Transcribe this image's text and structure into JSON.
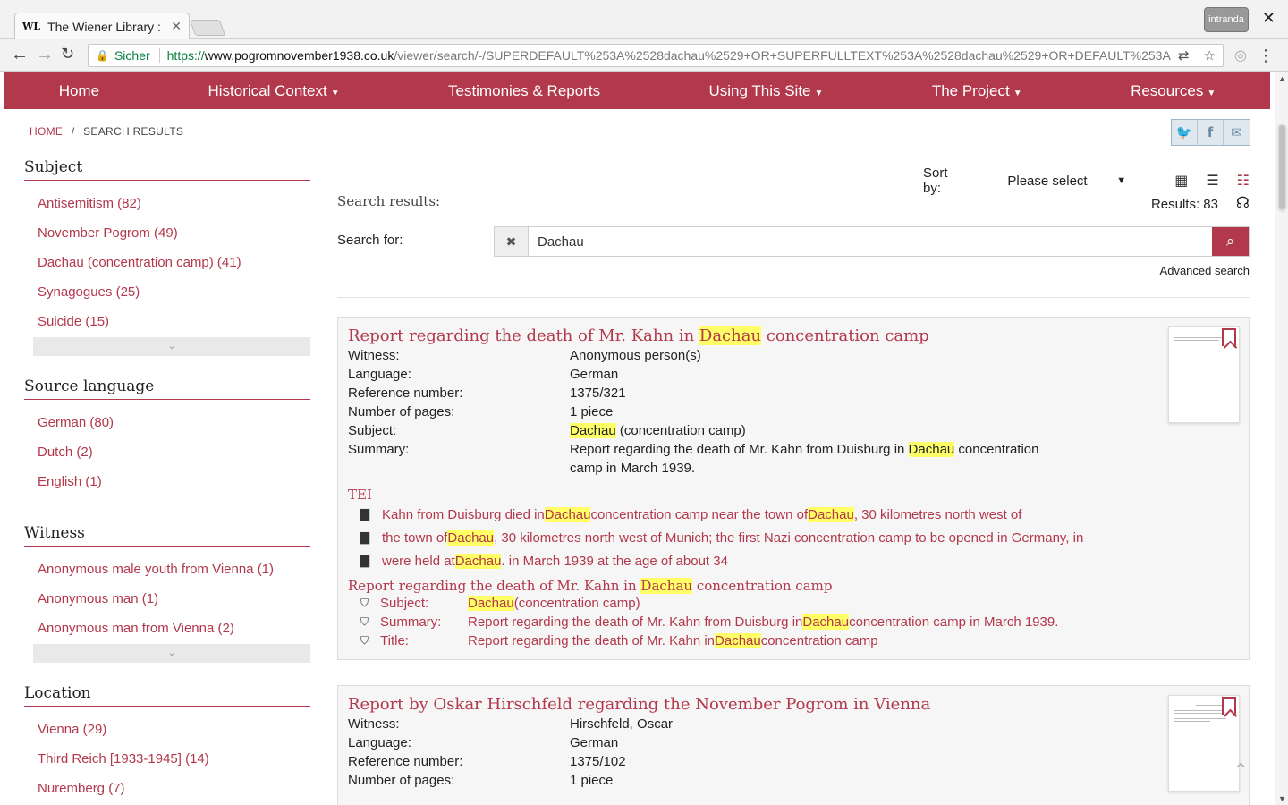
{
  "browser": {
    "tab_title": "The Wiener Library :",
    "tab_favicon": "WL",
    "incognito_label": "intranda",
    "secure_label": "Sicher",
    "url_scheme": "https://",
    "url_host": "www.pogromnovember1938.co.uk",
    "url_path": "/viewer/search/-/SUPERDEFAULT%253A%2528dachau%2529+OR+SUPERFULLTEXT%253A%2528dachau%2529+OR+DEFAULT%253A%252..."
  },
  "nav": {
    "items": [
      {
        "label": "Home",
        "caret": false
      },
      {
        "label": "Historical Context",
        "caret": true
      },
      {
        "label": "Testimonies & Reports",
        "caret": false
      },
      {
        "label": "Using This Site",
        "caret": true
      },
      {
        "label": "The Project",
        "caret": true
      },
      {
        "label": "Resources",
        "caret": true
      }
    ]
  },
  "breadcrumb": {
    "home": "HOME",
    "sep": "/",
    "current": "SEARCH RESULTS"
  },
  "facets": [
    {
      "title": "Subject",
      "items": [
        "Antisemitism (82)",
        "November Pogrom (49)",
        "Dachau (concentration camp) (41)",
        "Synagogues (25)",
        "Suicide (15)"
      ],
      "more": true
    },
    {
      "title": "Source language",
      "items": [
        "German (80)",
        "Dutch (2)",
        "English (1)"
      ],
      "more": false
    },
    {
      "title": "Witness",
      "items": [
        "Anonymous male youth from Vienna (1)",
        "Anonymous man (1)",
        "Anonymous man from Vienna (2)"
      ],
      "more": true
    },
    {
      "title": "Location",
      "items": [
        "Vienna (29)",
        "Third Reich [1933-1945] (14)",
        "Nuremberg (7)"
      ],
      "more": false
    }
  ],
  "search": {
    "sort_label": "Sort by:",
    "sort_value": "Please select",
    "results_label": "Search results:",
    "results_count": "Results: 83",
    "search_for_label": "Search for:",
    "query": "Dachau",
    "advanced": "Advanced search"
  },
  "hits": [
    {
      "title_pre": "Report regarding the death of Mr. Kahn in ",
      "title_hl": "Dachau",
      "title_post": " concentration camp",
      "meta": [
        {
          "k": "Witness:",
          "v": "Anonymous person(s)"
        },
        {
          "k": "Language:",
          "v": "German"
        },
        {
          "k": "Reference number:",
          "v": "1375/321"
        },
        {
          "k": "Number of pages:",
          "v": "1 piece"
        }
      ],
      "subject_hl": "Dachau",
      "subject_rest": " (concentration camp)",
      "summary_pre": "Report regarding the death of Mr. Kahn from Duisburg in ",
      "summary_hl": "Dachau",
      "summary_post": " concentration",
      "summary_line2": "camp in March 1939.",
      "tei_label": "TEI",
      "tei": [
        {
          "a": "Kahn from Duisburg died in ",
          "b": "Dachau",
          "c": " concentration camp near the town of ",
          "d": "Dachau",
          "e": ", 30 kilometres north west of"
        },
        {
          "a": "the town of ",
          "b": "Dachau",
          "c": ", 30 kilometres north west of Munich; the first Nazi concentration camp to be opened in Germany, in",
          "d": "",
          "e": ""
        },
        {
          "a": "were held at ",
          "b": "Dachau",
          "c": ". in March 1939 at the age of about 34",
          "d": "",
          "e": ""
        }
      ],
      "meta_head_pre": "Report regarding the death of Mr. Kahn in ",
      "meta_head_hl": "Dachau",
      "meta_head_post": " concentration camp",
      "meta_hits": [
        {
          "k": "Subject:",
          "pre": "",
          "hl": "Dachau",
          "post": " (concentration camp)"
        },
        {
          "k": "Summary:",
          "pre": "Report regarding the death of Mr. Kahn from Duisburg in ",
          "hl": "Dachau",
          "post": " concentration camp in March 1939."
        },
        {
          "k": "Title:",
          "pre": "Report regarding the death of Mr. Kahn in ",
          "hl": "Dachau",
          "post": " concentration camp"
        }
      ]
    },
    {
      "title": "Report by Oskar Hirschfeld regarding the November Pogrom in Vienna",
      "meta": [
        {
          "k": "Witness:",
          "v": "Hirschfeld, Oscar"
        },
        {
          "k": "Language:",
          "v": "German"
        },
        {
          "k": "Reference number:",
          "v": "1375/102"
        },
        {
          "k": "Number of pages:",
          "v": "1 piece"
        }
      ]
    }
  ],
  "labels": {
    "subject": "Subject:",
    "summary": "Summary:"
  },
  "colors": {
    "accent": "#b2384b",
    "highlight": "#ffff66"
  }
}
